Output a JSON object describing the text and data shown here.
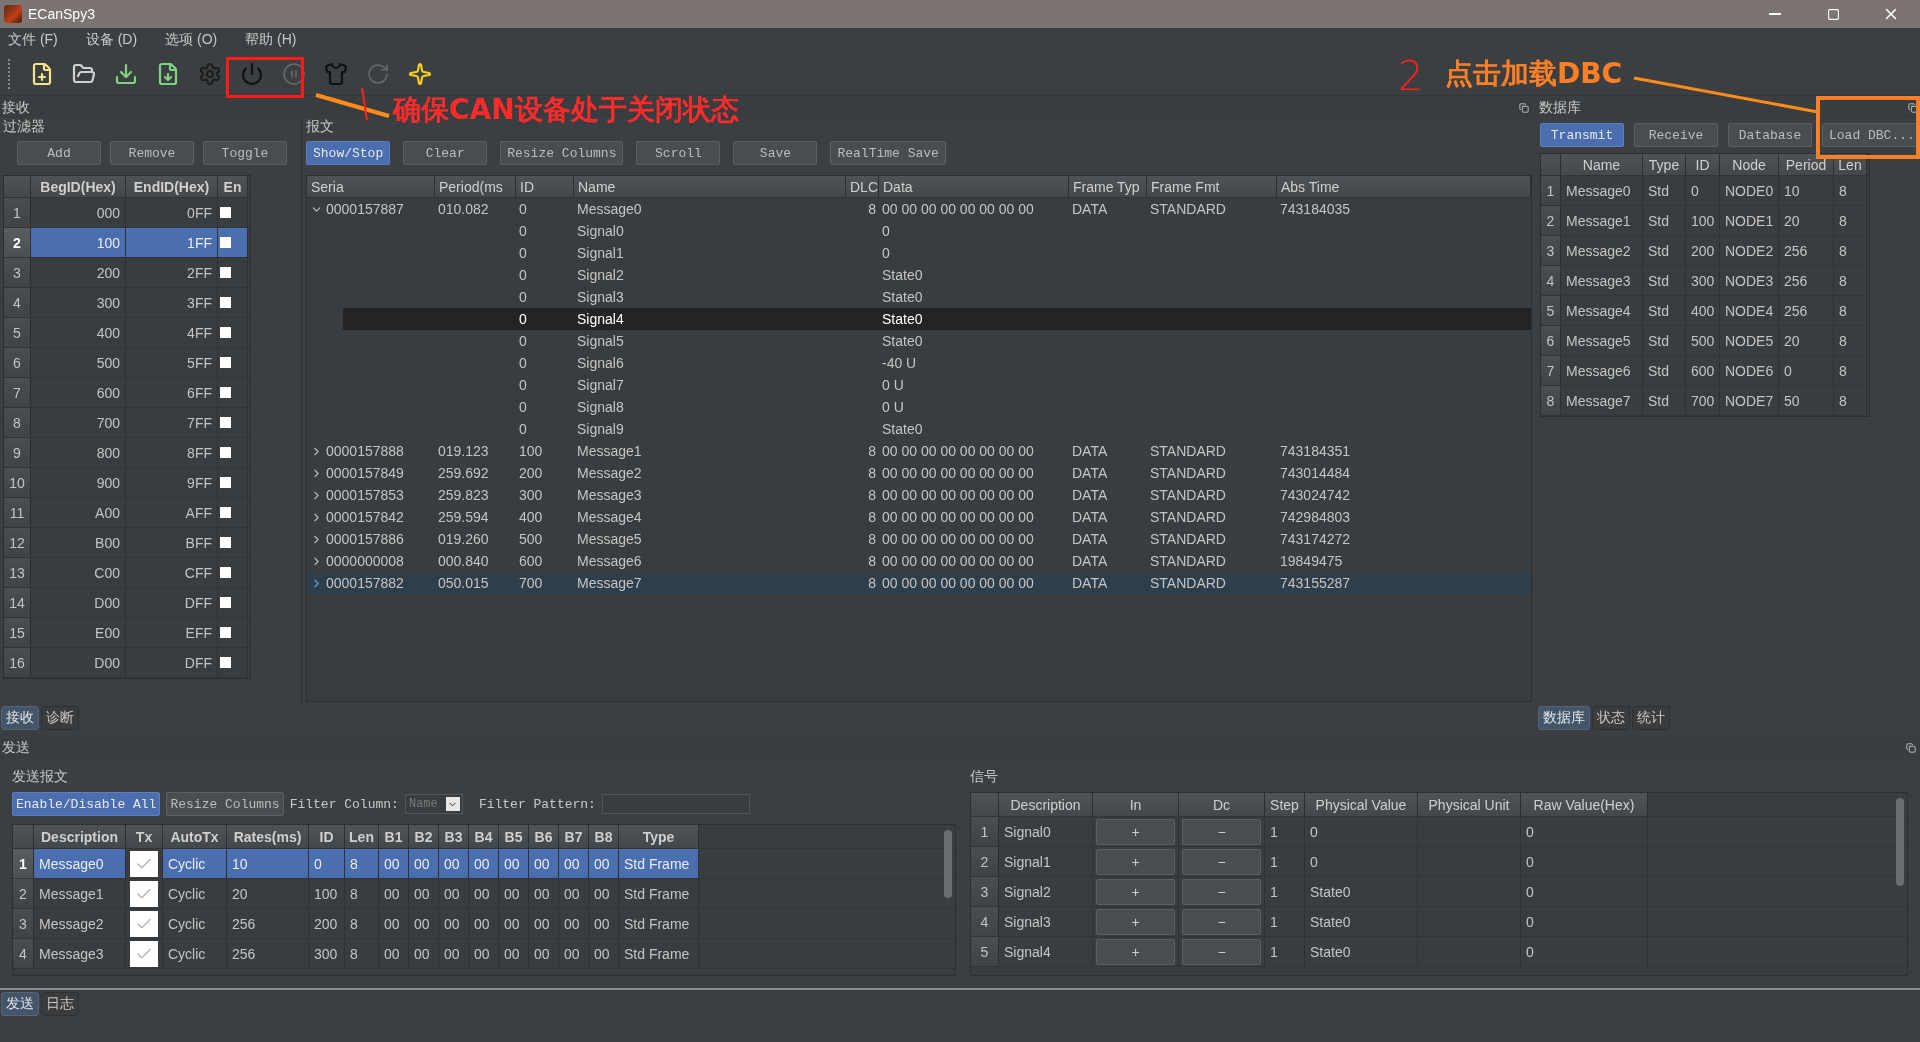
{
  "window": {
    "title": "ECanSpy3"
  },
  "menu": [
    "文件 (F)",
    "设备 (D)",
    "选项 (O)",
    "帮助 (H)"
  ],
  "toolbar": [
    {
      "disabled": false
    },
    {
      "disabled": false
    },
    {
      "disabled": false
    },
    {
      "disabled": false
    },
    {
      "disabled": false
    },
    {
      "disabled": false
    },
    {
      "disabled": true
    },
    {
      "disabled": false
    },
    {
      "disabled": true
    },
    {
      "disabled": false
    }
  ],
  "receive": {
    "title": "接收",
    "filter": {
      "title": "过滤器",
      "buttons": [
        "Add",
        "Remove",
        "Toggle"
      ],
      "columns": [
        "BegID(Hex)",
        "EndID(Hex)",
        "En"
      ],
      "rows": [
        {
          "index": "1",
          "begin": "000",
          "end": "0FF",
          "checked": false,
          "selected": false
        },
        {
          "index": "2",
          "begin": "100",
          "end": "1FF",
          "checked": false,
          "selected": true
        },
        {
          "index": "3",
          "begin": "200",
          "end": "2FF",
          "checked": false,
          "selected": false
        },
        {
          "index": "4",
          "begin": "300",
          "end": "3FF",
          "checked": false,
          "selected": false
        },
        {
          "index": "5",
          "begin": "400",
          "end": "4FF",
          "checked": false,
          "selected": false
        },
        {
          "index": "6",
          "begin": "500",
          "end": "5FF",
          "checked": false,
          "selected": false
        },
        {
          "index": "7",
          "begin": "600",
          "end": "6FF",
          "checked": false,
          "selected": false
        },
        {
          "index": "8",
          "begin": "700",
          "end": "7FF",
          "checked": false,
          "selected": false
        },
        {
          "index": "9",
          "begin": "800",
          "end": "8FF",
          "checked": false,
          "selected": false
        },
        {
          "index": "10",
          "begin": "900",
          "end": "9FF",
          "checked": false,
          "selected": false
        },
        {
          "index": "11",
          "begin": "A00",
          "end": "AFF",
          "checked": false,
          "selected": false
        },
        {
          "index": "12",
          "begin": "B00",
          "end": "BFF",
          "checked": false,
          "selected": false
        },
        {
          "index": "13",
          "begin": "C00",
          "end": "CFF",
          "checked": false,
          "selected": false
        },
        {
          "index": "14",
          "begin": "D00",
          "end": "DFF",
          "checked": false,
          "selected": false
        },
        {
          "index": "15",
          "begin": "E00",
          "end": "EFF",
          "checked": false,
          "selected": false
        },
        {
          "index": "16",
          "begin": "D00",
          "end": "DFF",
          "checked": false,
          "selected": false
        }
      ]
    },
    "messages": {
      "title": "报文",
      "buttons": [
        {
          "label": "Show/Stop",
          "active": true
        },
        {
          "label": "Clear",
          "active": false
        },
        {
          "label": "Resize Columns",
          "active": false
        },
        {
          "label": "Scroll",
          "active": false
        },
        {
          "label": "Save",
          "active": false
        },
        {
          "label": "RealTime Save",
          "active": false
        }
      ],
      "columns": [
        "Seria",
        "Period(ms",
        "ID",
        "Name",
        "DLC",
        "Data",
        "Frame Typ",
        "Frame Fmt",
        "Abs Time"
      ],
      "rows": [
        {
          "serial": "0000157887",
          "period": "010.082",
          "id": "0",
          "name": "Message0",
          "dlc": "8",
          "data": "00 00 00 00 00 00 00 00",
          "frame_type": "DATA",
          "frame_fmt": "STANDARD",
          "abs_time": "743184035",
          "expanded": true,
          "selected": false,
          "children": [
            {
              "id": "0",
              "name": "Signal0",
              "value": "0",
              "hovered": false
            },
            {
              "id": "0",
              "name": "Signal1",
              "value": "0",
              "hovered": false
            },
            {
              "id": "0",
              "name": "Signal2",
              "value": "State0",
              "hovered": false
            },
            {
              "id": "0",
              "name": "Signal3",
              "value": "State0",
              "hovered": false
            },
            {
              "id": "0",
              "name": "Signal4",
              "value": "State0",
              "hovered": true
            },
            {
              "id": "0",
              "name": "Signal5",
              "value": "State0",
              "hovered": false
            },
            {
              "id": "0",
              "name": "Signal6",
              "value": "-40 U",
              "hovered": false
            },
            {
              "id": "0",
              "name": "Signal7",
              "value": "0 U",
              "hovered": false
            },
            {
              "id": "0",
              "name": "Signal8",
              "value": "0 U",
              "hovered": false
            },
            {
              "id": "0",
              "name": "Signal9",
              "value": "State0",
              "hovered": false
            }
          ]
        },
        {
          "serial": "0000157888",
          "period": "019.123",
          "id": "100",
          "name": "Message1",
          "dlc": "8",
          "data": "00 00 00 00 00 00 00 00",
          "frame_type": "DATA",
          "frame_fmt": "STANDARD",
          "abs_time": "743184351",
          "expanded": false,
          "selected": false
        },
        {
          "serial": "0000157849",
          "period": "259.692",
          "id": "200",
          "name": "Message2",
          "dlc": "8",
          "data": "00 00 00 00 00 00 00 00",
          "frame_type": "DATA",
          "frame_fmt": "STANDARD",
          "abs_time": "743014484",
          "expanded": false,
          "selected": false
        },
        {
          "serial": "0000157853",
          "period": "259.823",
          "id": "300",
          "name": "Message3",
          "dlc": "8",
          "data": "00 00 00 00 00 00 00 00",
          "frame_type": "DATA",
          "frame_fmt": "STANDARD",
          "abs_time": "743024742",
          "expanded": false,
          "selected": false
        },
        {
          "serial": "0000157842",
          "period": "259.594",
          "id": "400",
          "name": "Message4",
          "dlc": "8",
          "data": "00 00 00 00 00 00 00 00",
          "frame_type": "DATA",
          "frame_fmt": "STANDARD",
          "abs_time": "742984803",
          "expanded": false,
          "selected": false
        },
        {
          "serial": "0000157886",
          "period": "019.260",
          "id": "500",
          "name": "Message5",
          "dlc": "8",
          "data": "00 00 00 00 00 00 00 00",
          "frame_type": "DATA",
          "frame_fmt": "STANDARD",
          "abs_time": "743174272",
          "expanded": false,
          "selected": false
        },
        {
          "serial": "0000000008",
          "period": "000.840",
          "id": "600",
          "name": "Message6",
          "dlc": "8",
          "data": "00 00 00 00 00 00 00 00",
          "frame_type": "DATA",
          "frame_fmt": "STANDARD",
          "abs_time": "19849475",
          "expanded": false,
          "selected": false
        },
        {
          "serial": "0000157882",
          "period": "050.015",
          "id": "700",
          "name": "Message7",
          "dlc": "8",
          "data": "00 00 00 00 00 00 00 00",
          "frame_type": "DATA",
          "frame_fmt": "STANDARD",
          "abs_time": "743155287",
          "expanded": false,
          "selected": true
        }
      ]
    },
    "tabs": [
      {
        "label": "接收",
        "selected": true
      },
      {
        "label": "诊断",
        "selected": false
      }
    ]
  },
  "database": {
    "title": "数据库",
    "buttons": [
      {
        "label": "Transmit",
        "active": true
      },
      {
        "label": "Receive",
        "active": false
      },
      {
        "label": "Database",
        "active": false
      },
      {
        "label": "Load DBC...",
        "active": false
      }
    ],
    "columns": [
      "Name",
      "Type",
      "ID",
      "Node",
      "Period",
      "Len"
    ],
    "rows": [
      {
        "index": "1",
        "name": "Message0",
        "type": "Std",
        "id": "0",
        "node": "NODE0",
        "period": "10",
        "len": "8"
      },
      {
        "index": "2",
        "name": "Message1",
        "type": "Std",
        "id": "100",
        "node": "NODE1",
        "period": "20",
        "len": "8"
      },
      {
        "index": "3",
        "name": "Message2",
        "type": "Std",
        "id": "200",
        "node": "NODE2",
        "period": "256",
        "len": "8"
      },
      {
        "index": "4",
        "name": "Message3",
        "type": "Std",
        "id": "300",
        "node": "NODE3",
        "period": "256",
        "len": "8"
      },
      {
        "index": "5",
        "name": "Message4",
        "type": "Std",
        "id": "400",
        "node": "NODE4",
        "period": "256",
        "len": "8"
      },
      {
        "index": "6",
        "name": "Message5",
        "type": "Std",
        "id": "500",
        "node": "NODE5",
        "period": "20",
        "len": "8"
      },
      {
        "index": "7",
        "name": "Message6",
        "type": "Std",
        "id": "600",
        "node": "NODE6",
        "period": "0",
        "len": "8"
      },
      {
        "index": "8",
        "name": "Message7",
        "type": "Std",
        "id": "700",
        "node": "NODE7",
        "period": "50",
        "len": "8"
      }
    ],
    "tabs": [
      {
        "label": "数据库",
        "selected": true
      },
      {
        "label": "状态",
        "selected": false
      },
      {
        "label": "统计",
        "selected": false
      }
    ]
  },
  "send": {
    "title": "发送",
    "messages": {
      "title": "发送报文",
      "buttons": [
        {
          "label": "Enable/Disable All",
          "active": true
        },
        {
          "label": "Resize Columns",
          "active": false
        }
      ],
      "filter_column_label": "Filter Column:",
      "filter_column_value": "Name",
      "filter_pattern_label": "Filter Pattern:",
      "columns": [
        "Description",
        "Tx",
        "AutoTx",
        "Rates(ms)",
        "ID",
        "Len",
        "B1",
        "B2",
        "B3",
        "B4",
        "B5",
        "B6",
        "B7",
        "B8",
        "Type"
      ],
      "rows": [
        {
          "index": "1",
          "description": "Message0",
          "tx": true,
          "auto_tx": "Cyclic",
          "rate": "10",
          "id": "0",
          "len": "8",
          "bytes": [
            "00",
            "00",
            "00",
            "00",
            "00",
            "00",
            "00",
            "00"
          ],
          "type": "Std Frame",
          "selected": true
        },
        {
          "index": "2",
          "description": "Message1",
          "tx": true,
          "auto_tx": "Cyclic",
          "rate": "20",
          "id": "100",
          "len": "8",
          "bytes": [
            "00",
            "00",
            "00",
            "00",
            "00",
            "00",
            "00",
            "00"
          ],
          "type": "Std Frame",
          "selected": false
        },
        {
          "index": "3",
          "description": "Message2",
          "tx": true,
          "auto_tx": "Cyclic",
          "rate": "256",
          "id": "200",
          "len": "8",
          "bytes": [
            "00",
            "00",
            "00",
            "00",
            "00",
            "00",
            "00",
            "00"
          ],
          "type": "Std Frame",
          "selected": false
        },
        {
          "index": "4",
          "description": "Message3",
          "tx": true,
          "auto_tx": "Cyclic",
          "rate": "256",
          "id": "300",
          "len": "8",
          "bytes": [
            "00",
            "00",
            "00",
            "00",
            "00",
            "00",
            "00",
            "00"
          ],
          "type": "Std Frame",
          "selected": false
        }
      ]
    },
    "signals": {
      "title": "信号",
      "columns": [
        "Description",
        "In",
        "Dc",
        "Step",
        "Physical Value",
        "Physical Unit",
        "Raw Value(Hex)"
      ],
      "rows": [
        {
          "index": "1",
          "description": "Signal0",
          "in": "+",
          "dc": "−",
          "step": "1",
          "value": "0",
          "raw": "0"
        },
        {
          "index": "2",
          "description": "Signal1",
          "in": "+",
          "dc": "−",
          "step": "1",
          "value": "0",
          "raw": "0"
        },
        {
          "index": "3",
          "description": "Signal2",
          "in": "+",
          "dc": "−",
          "step": "1",
          "value": "State0",
          "raw": "0"
        },
        {
          "index": "4",
          "description": "Signal3",
          "in": "+",
          "dc": "−",
          "step": "1",
          "value": "State0",
          "raw": "0"
        },
        {
          "index": "5",
          "description": "Signal4",
          "in": "+",
          "dc": "−",
          "step": "1",
          "value": "State0",
          "raw": "0"
        }
      ]
    },
    "tabs": [
      {
        "label": "发送",
        "selected": true
      },
      {
        "label": "日志",
        "selected": false
      }
    ]
  },
  "annotations": {
    "device_note": "确保CAN设备处于关闭状态",
    "step_number": "2",
    "load_note": "点击加载DBC"
  }
}
